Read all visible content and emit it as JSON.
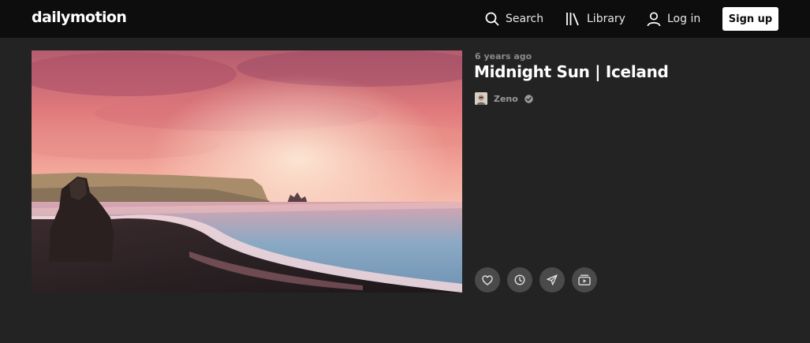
{
  "header": {
    "logo": "dailymotion",
    "search_label": "Search",
    "library_label": "Library",
    "login_label": "Log in",
    "signup_label": "Sign up"
  },
  "video": {
    "age": "6 years ago",
    "title": "Midnight Sun | Iceland",
    "channel": "Zeno",
    "verified": true
  },
  "actions": [
    "heart-icon",
    "clock-icon",
    "share-icon",
    "playlist-icon"
  ],
  "colors": {
    "header_bg": "#0d0d0d",
    "page_bg": "#232323",
    "action_bg": "#4a4a4a",
    "signup_bg": "#ffffff"
  }
}
